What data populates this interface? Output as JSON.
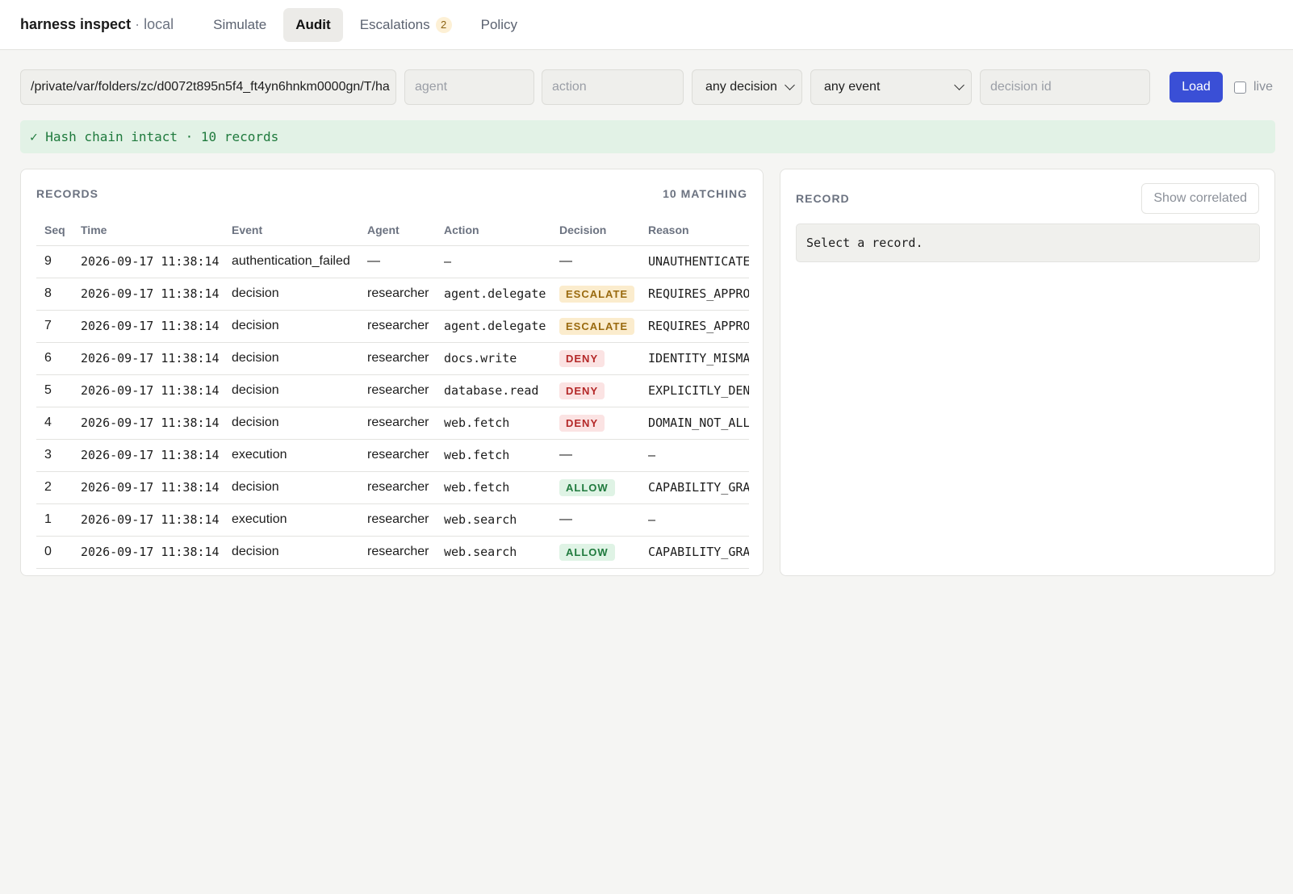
{
  "app": {
    "name": "harness inspect",
    "separator": "·",
    "env": "local"
  },
  "tabs": [
    {
      "label": "Simulate",
      "active": false
    },
    {
      "label": "Audit",
      "active": true
    },
    {
      "label": "Escalations",
      "badge": "2",
      "active": false
    },
    {
      "label": "Policy",
      "active": false
    }
  ],
  "filters": {
    "path_value": "/private/var/folders/zc/d0072t895n5f4_ft4yn6hnkm0000gn/T/ha",
    "agent_placeholder": "agent",
    "action_placeholder": "action",
    "decision_select": "any decision",
    "event_select": "any event",
    "decision_id_placeholder": "decision id",
    "load_label": "Load",
    "live_label": "live"
  },
  "banner": {
    "text": "✓ Hash chain intact · 10 records"
  },
  "records": {
    "title": "RECORDS",
    "matching": "10 MATCHING",
    "columns": [
      "Seq",
      "Time",
      "Event",
      "Agent",
      "Action",
      "Decision",
      "Reason"
    ],
    "rows": [
      {
        "seq": "9",
        "time": "2026-09-17 11:38:14",
        "event": "authentication_failed",
        "agent": "—",
        "action": "—",
        "decision": "—",
        "reason": "UNAUTHENTICATED"
      },
      {
        "seq": "8",
        "time": "2026-09-17 11:38:14",
        "event": "decision",
        "agent": "researcher",
        "action": "agent.delegate",
        "decision": "ESCALATE",
        "reason": "REQUIRES_APPROVAL"
      },
      {
        "seq": "7",
        "time": "2026-09-17 11:38:14",
        "event": "decision",
        "agent": "researcher",
        "action": "agent.delegate",
        "decision": "ESCALATE",
        "reason": "REQUIRES_APPROVAL"
      },
      {
        "seq": "6",
        "time": "2026-09-17 11:38:14",
        "event": "decision",
        "agent": "researcher",
        "action": "docs.write",
        "decision": "DENY",
        "reason": "IDENTITY_MISMATCH"
      },
      {
        "seq": "5",
        "time": "2026-09-17 11:38:14",
        "event": "decision",
        "agent": "researcher",
        "action": "database.read",
        "decision": "DENY",
        "reason": "EXPLICITLY_DENIED"
      },
      {
        "seq": "4",
        "time": "2026-09-17 11:38:14",
        "event": "decision",
        "agent": "researcher",
        "action": "web.fetch",
        "decision": "DENY",
        "reason": "DOMAIN_NOT_ALLOWED"
      },
      {
        "seq": "3",
        "time": "2026-09-17 11:38:14",
        "event": "execution",
        "agent": "researcher",
        "action": "web.fetch",
        "decision": "—",
        "reason": "—"
      },
      {
        "seq": "2",
        "time": "2026-09-17 11:38:14",
        "event": "decision",
        "agent": "researcher",
        "action": "web.fetch",
        "decision": "ALLOW",
        "reason": "CAPABILITY_GRANTED"
      },
      {
        "seq": "1",
        "time": "2026-09-17 11:38:14",
        "event": "execution",
        "agent": "researcher",
        "action": "web.search",
        "decision": "—",
        "reason": "—"
      },
      {
        "seq": "0",
        "time": "2026-09-17 11:38:14",
        "event": "decision",
        "agent": "researcher",
        "action": "web.search",
        "decision": "ALLOW",
        "reason": "CAPABILITY_GRANTED"
      }
    ]
  },
  "record": {
    "title": "RECORD",
    "show_correlated_label": "Show correlated",
    "empty_text": "Select a record."
  },
  "colors": {
    "accent": "#3a4fd6",
    "allow": "#1f7a3d",
    "deny": "#b42828",
    "escalate": "#9a6a0f",
    "banner_bg": "#e2f2e6"
  }
}
